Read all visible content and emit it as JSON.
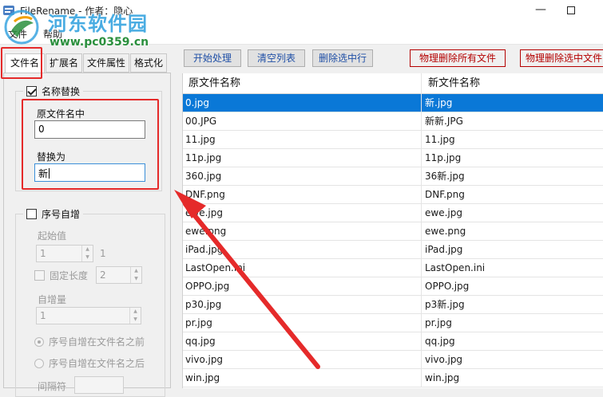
{
  "window": {
    "title": "FileRename - 作者：隐心",
    "minimize_glyph": "—",
    "maximize_icon": "maximize-icon"
  },
  "watermark": {
    "line1": "河东软件园",
    "line2": "www.pc0359.cn"
  },
  "menu": [
    "文件",
    "帮助"
  ],
  "tabs": [
    {
      "label": "文件名",
      "active": true
    },
    {
      "label": "扩展名",
      "active": false
    },
    {
      "label": "文件属性",
      "active": false
    },
    {
      "label": "格式化",
      "active": false
    }
  ],
  "name_replace": {
    "enabled": true,
    "label": "名称替换",
    "from_label": "原文件名中",
    "from_value": "0",
    "to_label": "替换为",
    "to_value": "新"
  },
  "sequence": {
    "enabled": false,
    "label": "序号自增",
    "start_label": "起始值",
    "start_value": "1",
    "start_hint": "1",
    "fixed_length_label": "固定长度",
    "fixed_length_value": "2",
    "step_label": "自增量",
    "step_value": "1",
    "radio_before": "序号自增在文件名之前",
    "radio_after": "序号自增在文件名之后",
    "separator_label": "间隔符"
  },
  "toolbar": {
    "start": "开始处理",
    "clear": "清空列表",
    "remove_selected": "删除选中行",
    "delete_all_files": "物理删除所有文件",
    "delete_selected_files": "物理删除选中文件"
  },
  "table": {
    "headers": [
      "原文件名称",
      "新文件名称"
    ],
    "selected_index": 0,
    "rows": [
      [
        "0.jpg",
        "新.jpg"
      ],
      [
        "00.JPG",
        "新新.JPG"
      ],
      [
        "11.jpg",
        "11.jpg"
      ],
      [
        "11p.jpg",
        "11p.jpg"
      ],
      [
        "360.jpg",
        "36新.jpg"
      ],
      [
        "DNF.png",
        "DNF.png"
      ],
      [
        "ewe.jpg",
        "ewe.jpg"
      ],
      [
        "ewe.png",
        "ewe.png"
      ],
      [
        "iPad.jpg",
        "iPad.jpg"
      ],
      [
        "LastOpen.ini",
        "LastOpen.ini"
      ],
      [
        "OPPO.jpg",
        "OPPO.jpg"
      ],
      [
        "p30.jpg",
        "p3新.jpg"
      ],
      [
        "pr.jpg",
        "pr.jpg"
      ],
      [
        "qq.jpg",
        "qq.jpg"
      ],
      [
        "vivo.jpg",
        "vivo.jpg"
      ],
      [
        "win.jpg",
        "win.jpg"
      ]
    ]
  },
  "colors": {
    "selection": "#0a78d7",
    "annotation": "#e52a2a",
    "danger_button": "#b40000",
    "button_text": "#1f4fa6"
  }
}
